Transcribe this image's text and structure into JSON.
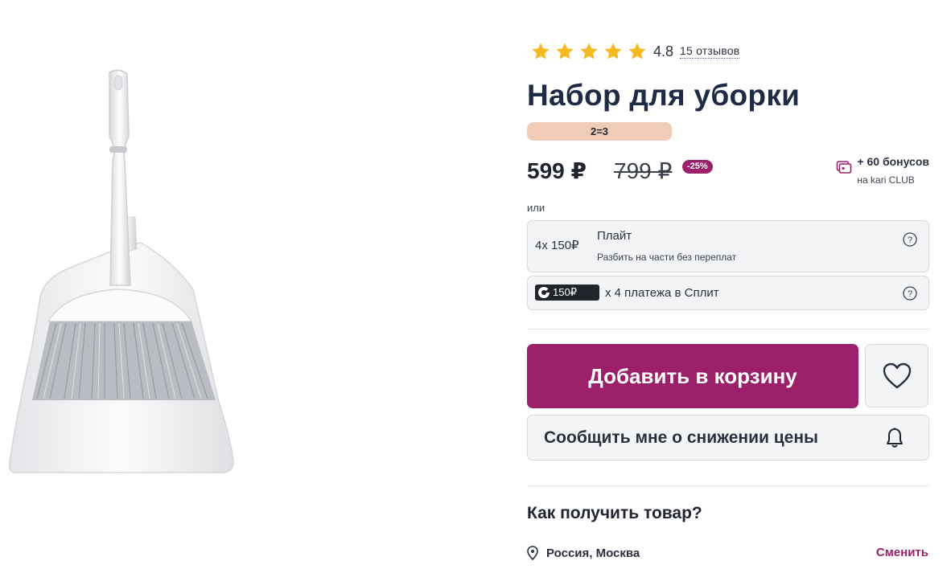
{
  "product": {
    "title": "Набор для уборки",
    "image_alt": "broom-and-dustpan",
    "rating": {
      "stars": 5,
      "value": "4.8",
      "reviews": "15 отзывов"
    },
    "promo_badge": "2=3",
    "price": "599 ₽",
    "old_price": "799 ₽",
    "discount": "-25%",
    "bonus": {
      "amount": "+ 60 бонусов",
      "program": "на kari CLUB"
    }
  },
  "payment": {
    "or_label": "или",
    "plait": {
      "amount": "4х 150₽",
      "name": "Плайт",
      "description": "Разбить на части без переплат",
      "help": "?"
    },
    "split": {
      "chip_amount": "150₽",
      "text": "х 4 платежа в Сплит",
      "help": "?"
    }
  },
  "actions": {
    "add_to_cart": "Добавить в корзину",
    "notify_price_drop": "Сообщить мне о снижении цены"
  },
  "delivery": {
    "title": "Как получить товар?",
    "location": "Россия, Москва",
    "change": "Сменить"
  },
  "colors": {
    "accent": "#9b1f69",
    "star": "#f5b921",
    "promo_bg": "#f0ccb8",
    "text_dark": "#1f2a44"
  }
}
